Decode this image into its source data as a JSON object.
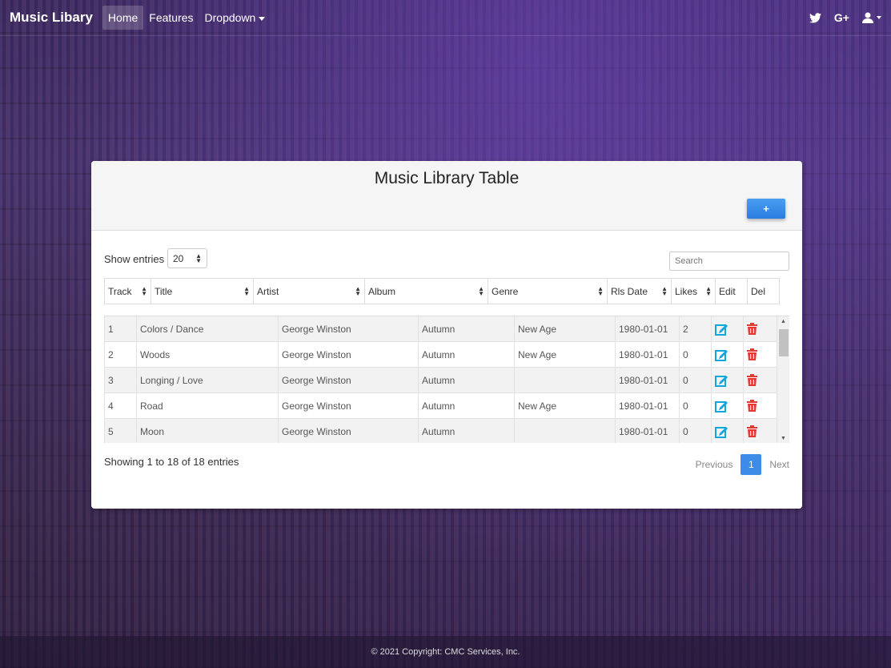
{
  "navbar": {
    "brand": "Music Libary",
    "links": [
      {
        "label": "Home",
        "active": true
      },
      {
        "label": "Features",
        "active": false
      },
      {
        "label": "Dropdown",
        "active": false
      }
    ],
    "icons": [
      "twitter-icon",
      "google-plus-icon",
      "user-icon"
    ],
    "google_plus_text": "G+"
  },
  "card": {
    "title": "Music Library Table",
    "add_label": "+"
  },
  "controls": {
    "show_entries_label": "Show entries",
    "entries_value": "20",
    "search_placeholder": "Search"
  },
  "table": {
    "columns": [
      "Track",
      "Title",
      "Artist",
      "Album",
      "Genre",
      "Rls Date",
      "Likes",
      "Edit",
      "Del"
    ],
    "rows": [
      {
        "track": "1",
        "title": "Colors / Dance",
        "artist": "George Winston",
        "album": "Autumn",
        "genre": "New Age",
        "date": "1980-01-01",
        "likes": "2"
      },
      {
        "track": "2",
        "title": "Woods",
        "artist": "George Winston",
        "album": "Autumn",
        "genre": "New Age",
        "date": "1980-01-01",
        "likes": "0"
      },
      {
        "track": "3",
        "title": "Longing / Love",
        "artist": "George Winston",
        "album": "Autumn",
        "genre": "",
        "date": "1980-01-01",
        "likes": "0"
      },
      {
        "track": "4",
        "title": "Road",
        "artist": "George Winston",
        "album": "Autumn",
        "genre": "New Age",
        "date": "1980-01-01",
        "likes": "0"
      },
      {
        "track": "5",
        "title": "Moon",
        "artist": "George Winston",
        "album": "Autumn",
        "genre": "",
        "date": "1980-01-01",
        "likes": "0"
      }
    ]
  },
  "info": "Showing 1 to 18 of 18 entries",
  "pagination": {
    "previous": "Previous",
    "current": "1",
    "next": "Next"
  },
  "footer": "© 2021 Copyright: CMC Services, Inc.",
  "colors": {
    "accent": "#3b8de8",
    "edit": "#10a8d8",
    "delete": "#e53935"
  }
}
